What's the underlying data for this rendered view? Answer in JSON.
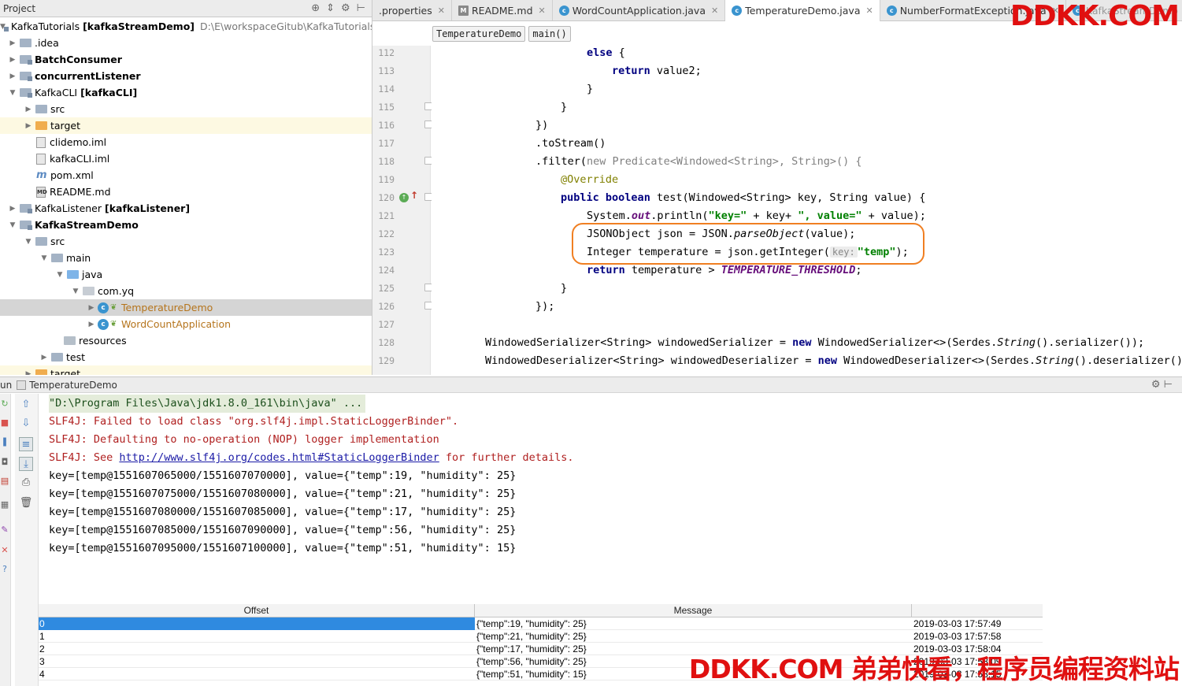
{
  "project": {
    "header_title": "Project",
    "tree": [
      {
        "label": "KafkaTutorials",
        "bold_suffix": "[kafkaStreamDemo]",
        "path": "D:\\E\\workspaceGitub\\KafkaTutorials"
      },
      {
        "label": ".idea"
      },
      {
        "label": "BatchConsumer"
      },
      {
        "label": "concurrentListener"
      },
      {
        "label": "KafkaCLI",
        "bold_suffix": "[kafkaCLI]"
      },
      {
        "label": "src"
      },
      {
        "label": "target"
      },
      {
        "label": "clidemo.iml"
      },
      {
        "label": "kafkaCLI.iml"
      },
      {
        "label": "pom.xml"
      },
      {
        "label": "README.md"
      },
      {
        "label": "KafkaListener",
        "bold_suffix": "[kafkaListener]"
      },
      {
        "label": "KafkaStreamDemo"
      },
      {
        "label": "src"
      },
      {
        "label": "main"
      },
      {
        "label": "java"
      },
      {
        "label": "com.yq"
      },
      {
        "label": "TemperatureDemo"
      },
      {
        "label": "WordCountApplication"
      },
      {
        "label": "resources"
      },
      {
        "label": "test"
      },
      {
        "label": "target"
      }
    ]
  },
  "editor": {
    "tabs": [
      {
        "label": ".properties",
        "icon": "properties-icon"
      },
      {
        "label": "README.md",
        "icon": "markdown-icon"
      },
      {
        "label": "WordCountApplication.java",
        "icon": "class-icon"
      },
      {
        "label": "TemperatureDemo.java",
        "icon": "class-icon",
        "active": true
      },
      {
        "label": "NumberFormatException.java",
        "icon": "class-icon"
      },
      {
        "label": "KafkaStreamDemo",
        "icon": "module-icon"
      }
    ],
    "breadcrumbs": [
      "TemperatureDemo",
      "main()"
    ],
    "line_numbers": [
      "112",
      "113",
      "114",
      "115",
      "116",
      "117",
      "118",
      "119",
      "120",
      "121",
      "122",
      "123",
      "124",
      "125",
      "126",
      "127",
      "128",
      "129"
    ],
    "code": {
      "l112_kw": "else",
      "l112_rest": " {",
      "l113_kw": "return",
      "l113_rest": " value2;",
      "l114": "}",
      "l115": "}",
      "l116": "})",
      "l117": ".toStream()",
      "l118_a": ".filter(",
      "l118_kw": "new",
      "l118_b": " Predicate<Windowed<String>, String>() {",
      "l119": "@Override",
      "l120_kw1": "public",
      "l120_kw2": "boolean",
      "l120_rest": " test(Windowed<String> key, String value) {",
      "l121_a": "System.",
      "l121_out": "out",
      "l121_b": ".println(",
      "l121_s1": "\"key=\"",
      "l121_c": " + key+ ",
      "l121_s2": "\", value=\"",
      "l121_d": " + value);",
      "l122_a": "JSONObject json = JSON.",
      "l122_it": "parseObject",
      "l122_b": "(value);",
      "l123_a": "Integer temperature = json.getInteger(",
      "l123_hint": "key:",
      "l123_s": "\"temp\"",
      "l123_b": ");",
      "l124_kw": "return",
      "l124_a": " temperature > ",
      "l124_const": "TEMPERATURE_THRESHOLD",
      "l124_b": ";",
      "l125": "}",
      "l126": "});",
      "l128_a": "WindowedSerializer<String> windowedSerializer = ",
      "l128_kw": "new",
      "l128_b": " WindowedSerializer<>(Serdes.",
      "l128_it": "String",
      "l128_c": "().serializer());",
      "l129_a": "WindowedDeserializer<String> windowedDeserializer = ",
      "l129_kw": "new",
      "l129_b": " WindowedDeserializer<>(Serdes.",
      "l129_it": "String",
      "l129_c": "().deserializer(),"
    }
  },
  "run": {
    "header_prefix": "un",
    "header_title": "TemperatureDemo",
    "console": {
      "cmd": "\"D:\\Program Files\\Java\\jdk1.8.0_161\\bin\\java\" ...",
      "err1": "SLF4J: Failed to load class \"org.slf4j.impl.StaticLoggerBinder\".",
      "err2": "SLF4J: Defaulting to no-operation (NOP) logger implementation",
      "err3_a": "SLF4J: See ",
      "err3_link": "http://www.slf4j.org/codes.html#StaticLoggerBinder",
      "err3_b": " for further details.",
      "out": [
        "key=[temp@1551607065000/1551607070000], value={\"temp\":19, \"humidity\": 25}",
        "key=[temp@1551607075000/1551607080000], value={\"temp\":21, \"humidity\": 25}",
        "key=[temp@1551607080000/1551607085000], value={\"temp\":17, \"humidity\": 25}",
        "key=[temp@1551607085000/1551607090000], value={\"temp\":56, \"humidity\": 25}",
        "key=[temp@1551607095000/1551607100000], value={\"temp\":51, \"humidity\": 15}"
      ]
    }
  },
  "table": {
    "headers": [
      "Offset",
      "Message"
    ],
    "rows": [
      {
        "offset": "0",
        "message": "{\"temp\":19, \"humidity\": 25}",
        "time": "2019-03-03 17:57:49"
      },
      {
        "offset": "1",
        "message": "{\"temp\":21, \"humidity\": 25}",
        "time": "2019-03-03 17:57:58"
      },
      {
        "offset": "2",
        "message": "{\"temp\":17, \"humidity\": 25}",
        "time": "2019-03-03 17:58:04"
      },
      {
        "offset": "3",
        "message": "{\"temp\":56, \"humidity\": 25}",
        "time": "2019-03-03 17:58:09"
      },
      {
        "offset": "4",
        "message": "{\"temp\":51, \"humidity\": 15}",
        "time": "2019-03-03 17:58:15"
      }
    ]
  },
  "watermarks": {
    "top": "DDKK.COM",
    "bottom": "DDKK.COM 弟弟快看，程序员编程资料站"
  },
  "colors": {
    "highlight_box": "#f07f22",
    "watermark": "#e01010",
    "selection": "#2f8ae0"
  }
}
